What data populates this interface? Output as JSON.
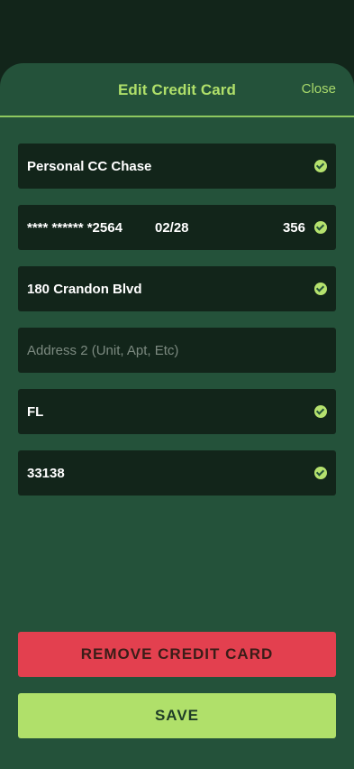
{
  "header": {
    "title": "Edit Credit Card",
    "close_label": "Close"
  },
  "fields": {
    "card_name": {
      "value": "Personal CC Chase"
    },
    "card": {
      "number": "**** ****** *2564",
      "expiry": "02/28",
      "cvv": "356"
    },
    "address1": {
      "value": "180 Crandon Blvd"
    },
    "address2": {
      "placeholder": "Address 2 (Unit, Apt, Etc)"
    },
    "state": {
      "value": "FL"
    },
    "zip": {
      "value": "33138"
    }
  },
  "actions": {
    "remove_label": "REMOVE CREDIT CARD",
    "save_label": "SAVE"
  },
  "colors": {
    "background": "#12251a",
    "sheet": "#24523a",
    "accent": "#b0e06a",
    "danger": "#e3404f",
    "field": "#12251a"
  },
  "icons": {
    "valid": "check-circle-icon"
  }
}
